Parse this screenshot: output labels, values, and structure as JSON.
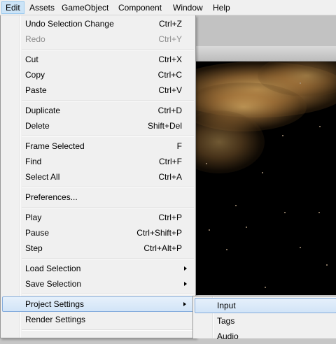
{
  "menubar": {
    "items": [
      {
        "label": "Edit",
        "active": true
      },
      {
        "label": "Assets"
      },
      {
        "label": "GameObject"
      },
      {
        "label": "Component"
      },
      {
        "label": "Window"
      },
      {
        "label": "Help"
      }
    ]
  },
  "edit_menu": {
    "items": [
      {
        "label": "Undo Selection Change",
        "shortcut": "Ctrl+Z"
      },
      {
        "label": "Redo",
        "shortcut": "Ctrl+Y",
        "disabled": true
      },
      {
        "label": "Cut",
        "shortcut": "Ctrl+X"
      },
      {
        "label": "Copy",
        "shortcut": "Ctrl+C"
      },
      {
        "label": "Paste",
        "shortcut": "Ctrl+V"
      },
      {
        "label": "Duplicate",
        "shortcut": "Ctrl+D"
      },
      {
        "label": "Delete",
        "shortcut": "Shift+Del"
      },
      {
        "label": "Frame Selected",
        "shortcut": "F"
      },
      {
        "label": "Find",
        "shortcut": "Ctrl+F"
      },
      {
        "label": "Select All",
        "shortcut": "Ctrl+A"
      },
      {
        "label": "Preferences..."
      },
      {
        "label": "Play",
        "shortcut": "Ctrl+P"
      },
      {
        "label": "Pause",
        "shortcut": "Ctrl+Shift+P"
      },
      {
        "label": "Step",
        "shortcut": "Ctrl+Alt+P"
      },
      {
        "label": "Load Selection",
        "submenu": true
      },
      {
        "label": "Save Selection",
        "submenu": true
      },
      {
        "label": "Project Settings",
        "submenu": true,
        "highlighted": true
      },
      {
        "label": "Render Settings"
      }
    ]
  },
  "project_settings_submenu": {
    "items": [
      {
        "label": "Input",
        "highlighted": true
      },
      {
        "label": "Tags"
      },
      {
        "label": "Audio"
      }
    ]
  },
  "colors": {
    "menu_bg": "#f0f0f0",
    "highlight_bg": "#d2e4f7",
    "highlight_border": "#84acdd",
    "disabled_text": "#8d8d8d",
    "scene_bg": "#000000",
    "cloud": "#d6aa62"
  }
}
